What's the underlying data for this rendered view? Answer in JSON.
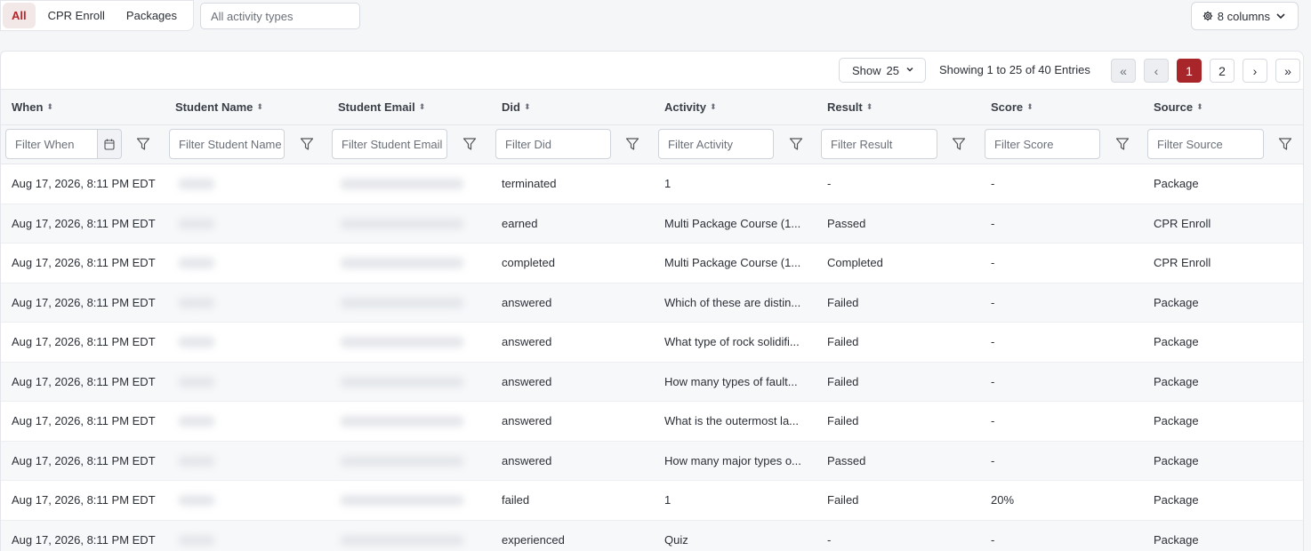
{
  "top": {
    "tabs": [
      {
        "label": "All",
        "active": true
      },
      {
        "label": "CPR Enroll",
        "active": false
      },
      {
        "label": "Packages",
        "active": false
      }
    ],
    "activity_type_placeholder": "All activity types",
    "columns_label": "8 columns"
  },
  "toolbar": {
    "show_label": "Show",
    "show_value": "25",
    "entries_text": "Showing 1 to 25 of 40 Entries",
    "pages": [
      "1",
      "2"
    ],
    "current_page": "1"
  },
  "columns": [
    {
      "label": "When",
      "filter_placeholder": "Filter When"
    },
    {
      "label": "Student Name",
      "filter_placeholder": "Filter Student Name"
    },
    {
      "label": "Student Email",
      "filter_placeholder": "Filter Student Email"
    },
    {
      "label": "Did",
      "filter_placeholder": "Filter Did"
    },
    {
      "label": "Activity",
      "filter_placeholder": "Filter Activity"
    },
    {
      "label": "Result",
      "filter_placeholder": "Filter Result"
    },
    {
      "label": "Score",
      "filter_placeholder": "Filter Score"
    },
    {
      "label": "Source",
      "filter_placeholder": "Filter Source"
    }
  ],
  "rows": [
    {
      "when": "Aug 17, 2026, 8:11 PM EDT",
      "did": "terminated",
      "activity": "1",
      "result": "-",
      "score": "-",
      "source": "Package"
    },
    {
      "when": "Aug 17, 2026, 8:11 PM EDT",
      "did": "earned",
      "activity": "Multi Package Course (1...",
      "result": "Passed",
      "score": "-",
      "source": "CPR Enroll"
    },
    {
      "when": "Aug 17, 2026, 8:11 PM EDT",
      "did": "completed",
      "activity": "Multi Package Course (1...",
      "result": "Completed",
      "score": "-",
      "source": "CPR Enroll"
    },
    {
      "when": "Aug 17, 2026, 8:11 PM EDT",
      "did": "answered",
      "activity": "Which of these are distin...",
      "result": "Failed",
      "score": "-",
      "source": "Package"
    },
    {
      "when": "Aug 17, 2026, 8:11 PM EDT",
      "did": "answered",
      "activity": "What type of rock solidifi...",
      "result": "Failed",
      "score": "-",
      "source": "Package"
    },
    {
      "when": "Aug 17, 2026, 8:11 PM EDT",
      "did": "answered",
      "activity": "How many types of fault...",
      "result": "Failed",
      "score": "-",
      "source": "Package"
    },
    {
      "when": "Aug 17, 2026, 8:11 PM EDT",
      "did": "answered",
      "activity": "What is the outermost la...",
      "result": "Failed",
      "score": "-",
      "source": "Package"
    },
    {
      "when": "Aug 17, 2026, 8:11 PM EDT",
      "did": "answered",
      "activity": "How many major types o...",
      "result": "Passed",
      "score": "-",
      "source": "Package"
    },
    {
      "when": "Aug 17, 2026, 8:11 PM EDT",
      "did": "failed",
      "activity": "1",
      "result": "Failed",
      "score": "20%",
      "source": "Package"
    },
    {
      "when": "Aug 17, 2026, 8:11 PM EDT",
      "did": "experienced",
      "activity": "Quiz",
      "result": "-",
      "score": "-",
      "source": "Package"
    }
  ]
}
